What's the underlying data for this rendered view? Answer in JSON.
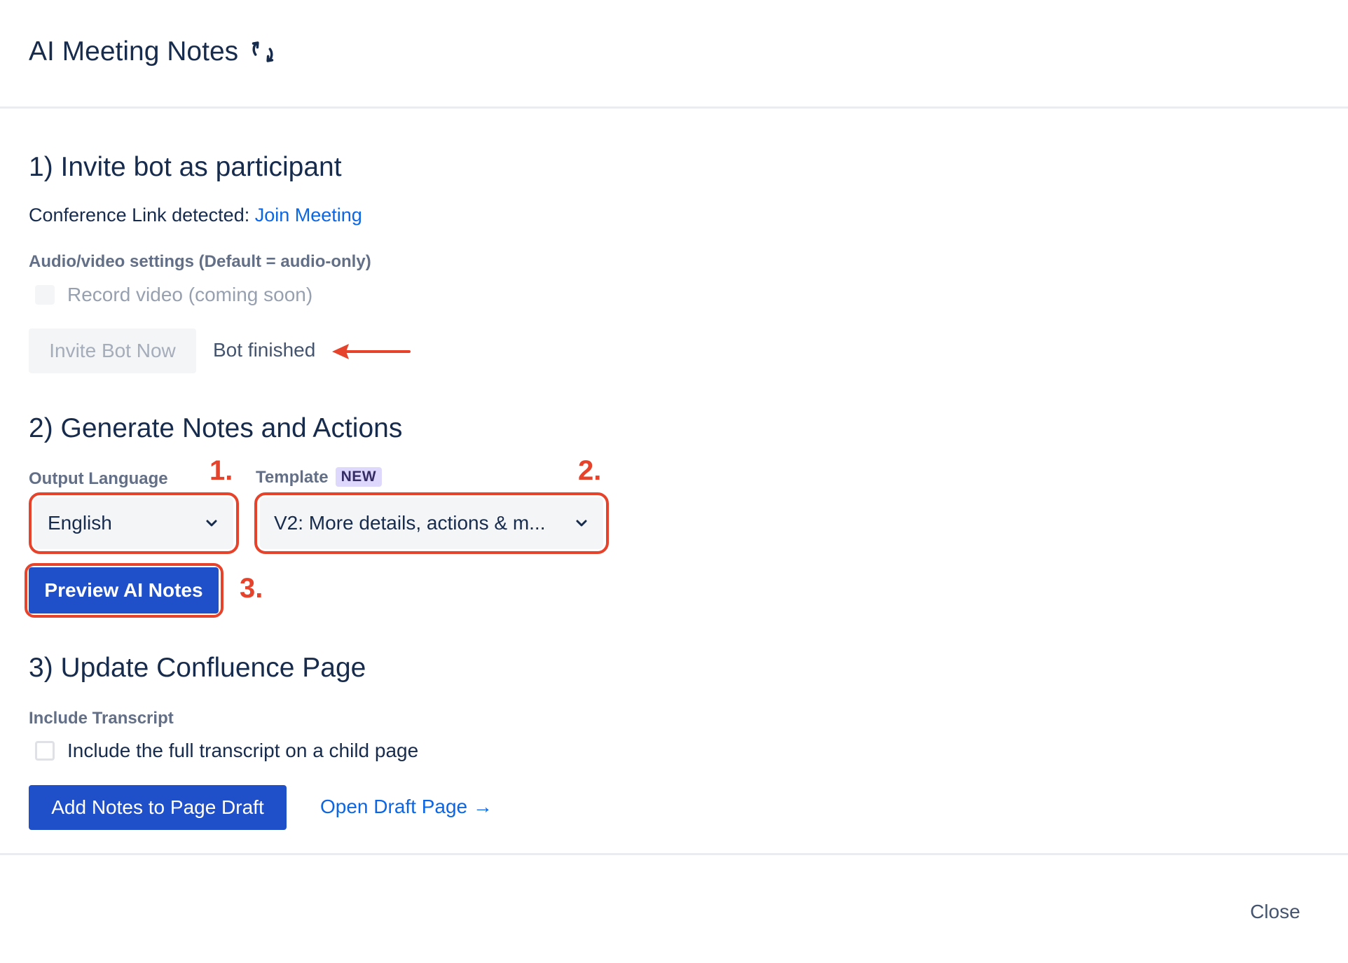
{
  "header": {
    "title": "AI Meeting Notes",
    "refresh_icon": "refresh-icon"
  },
  "section1": {
    "heading": "1) Invite bot as participant",
    "conference_prefix": "Conference Link detected:",
    "join_link": "Join Meeting",
    "av_settings_label": "Audio/video settings (Default = audio-only)",
    "record_video_label": "Record video (coming soon)",
    "record_video_checked": false,
    "invite_button": "Invite Bot Now",
    "bot_status": "Bot finished"
  },
  "section2": {
    "heading": "2) Generate Notes and Actions",
    "output_language_label": "Output Language",
    "output_language_value": "English",
    "template_label": "Template",
    "template_badge": "NEW",
    "template_value": "V2: More details, actions & m...",
    "preview_button": "Preview AI Notes"
  },
  "section3": {
    "heading": "3) Update Confluence Page",
    "include_transcript_label": "Include Transcript",
    "transcript_checkbox_label": "Include the full transcript on a child page",
    "transcript_checked": false,
    "add_notes_button": "Add Notes to Page Draft",
    "open_draft_link": "Open Draft Page →"
  },
  "annotations": {
    "step1": "1.",
    "step2": "2.",
    "step3": "3.",
    "color": "#e5432b"
  },
  "footer": {
    "close_button": "Close"
  },
  "colors": {
    "primary": "#1f4fc9",
    "link": "#0c66e4",
    "text": "#172b4d",
    "subtle": "#626f86"
  }
}
